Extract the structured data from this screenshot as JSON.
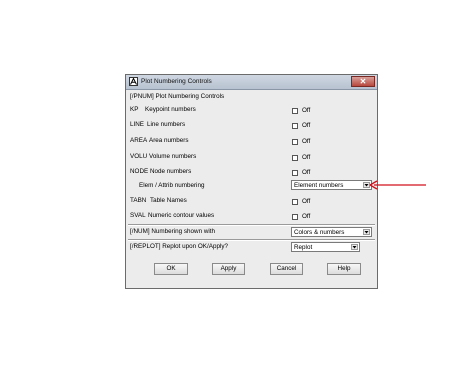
{
  "window": {
    "title": "Plot Numbering Controls",
    "close_glyph": "✕",
    "app_icon": "ansys-icon"
  },
  "section_pnum": "[/PNUM]  Plot Numbering Controls",
  "rows": [
    {
      "code": "KP",
      "label": "Keypoint numbers",
      "value": "Off"
    },
    {
      "code": "LINE",
      "label": "Line numbers",
      "value": "Off"
    },
    {
      "code": "AREA",
      "label": "Area numbers",
      "value": "Off"
    },
    {
      "code": "VOLU",
      "label": "Volume numbers",
      "value": "Off"
    },
    {
      "code": "NODE",
      "label": "Node numbers",
      "value": "Off"
    }
  ],
  "elem_row": {
    "label": "Elem / Attrib numbering",
    "selected": "Element numbers"
  },
  "rows2": [
    {
      "code": "TABN",
      "label": "Table Names",
      "value": "Off"
    },
    {
      "code": "SVAL",
      "label": "Numeric contour values",
      "value": "Off"
    }
  ],
  "num_row": {
    "label": "[/NUM]  Numbering shown with",
    "selected": "Colors & numbers"
  },
  "replot_row": {
    "label": "[/REPLOT]  Replot upon OK/Apply?",
    "selected": "Replot"
  },
  "buttons": {
    "ok": "OK",
    "apply": "Apply",
    "cancel": "Cancel",
    "help": "Help"
  },
  "annotation": {
    "color": "#d0101a"
  }
}
